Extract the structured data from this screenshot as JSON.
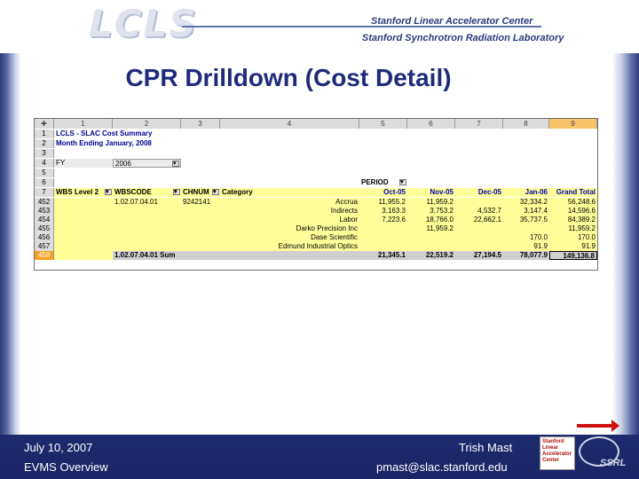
{
  "header": {
    "logo": "LCLS",
    "line1": "Stanford Linear Accelerator Center",
    "line2": "Stanford Synchrotron Radiation Laboratory"
  },
  "slide": {
    "title": "CPR Drilldown (Cost Detail)"
  },
  "sheet": {
    "columns": [
      "1",
      "2",
      "3",
      "4",
      "5",
      "6",
      "7",
      "8",
      "9"
    ],
    "r1": {
      "num": "1",
      "text": "LCLS - SLAC Cost Summary"
    },
    "r2": {
      "num": "2",
      "text": "Month Ending January, 2008"
    },
    "r3": {
      "num": "3"
    },
    "r4": {
      "num": "4",
      "label": "FY",
      "value": "2006"
    },
    "r5": {
      "num": "5"
    },
    "r6": {
      "num": "6",
      "period": "PERIOD"
    },
    "r7": {
      "num": "7",
      "wbs2": "WBS Level 2",
      "wbscode": "WBSCODE",
      "chnum": "CHNUM",
      "category": "Category",
      "months": [
        "Oct-05",
        "Nov-05",
        "Dec-05",
        "Jan-06"
      ],
      "total": "Grand Total"
    },
    "rows": [
      {
        "num": "452",
        "wbscode": "1.02.07.04.01",
        "chnum": "9242141",
        "category": "Accrua",
        "v": [
          "11,955.2",
          "11,959.2",
          "",
          "32,334.2",
          "56,248.6"
        ]
      },
      {
        "num": "453",
        "category": "Indirects",
        "v": [
          "3,163.3",
          "3,753.2",
          "4,532.7",
          "3,147.4",
          "14,596.6"
        ]
      },
      {
        "num": "454",
        "category": "Labor",
        "v": [
          "7,223.6",
          "18,766.0",
          "22,662.1",
          "35,737.5",
          "84,389.2"
        ]
      },
      {
        "num": "455",
        "category": "Darko Precision Inc",
        "v": [
          "",
          "11,959.2",
          "",
          "",
          "11,959.2"
        ]
      },
      {
        "num": "456",
        "category": "Dase Scientific",
        "v": [
          "",
          "",
          "",
          "170.0",
          "170.0"
        ]
      },
      {
        "num": "457",
        "category": "Edmund Industrial Optics",
        "v": [
          "",
          "",
          "",
          "91.9",
          "91.9"
        ]
      }
    ],
    "sum": {
      "num": "458",
      "label": "1.02.07.04.01 Sum",
      "v": [
        "21,345.1",
        "22,519.2",
        "27,194.5",
        "78,077.9",
        "149,136.8"
      ]
    }
  },
  "footer": {
    "date": "July 10, 2007",
    "presenter": "Trish Mast",
    "event": "EVMS Overview",
    "email": "pmast@slac.stanford.edu",
    "lab_logo": "Stanford Linear Accelerator Center",
    "ssrl": "SSRL"
  },
  "colors": {
    "nav_blue": "#1f2a6e",
    "title_blue": "#1f2b7a",
    "highlight": "#ffff99",
    "selected": "#f6a024"
  }
}
